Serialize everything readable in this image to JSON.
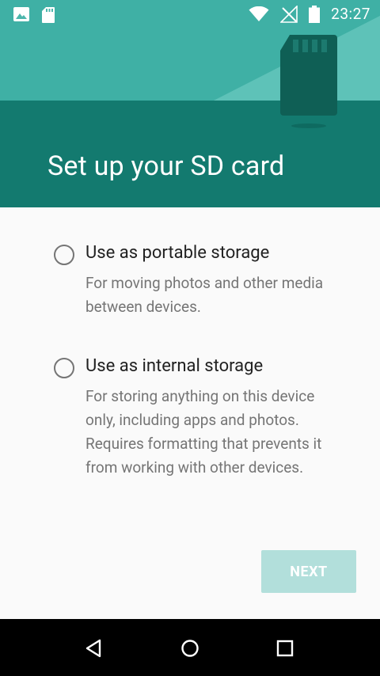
{
  "status_bar": {
    "time": "23:27",
    "icons": [
      "image-icon",
      "sd-card-icon",
      "wifi-icon",
      "no-signal-icon",
      "battery-icon"
    ]
  },
  "header": {
    "title": "Set up your SD card",
    "illustration": "sd-card-icon",
    "colors": {
      "top": "#26a69a",
      "bottom": "#137a6f"
    }
  },
  "options": [
    {
      "title": "Use as portable storage",
      "description": "For moving photos and other media between devices."
    },
    {
      "title": "Use as internal storage",
      "description": "For storing anything on this device only, including apps and photos. Requires formatting that prevents it from working with other devices."
    }
  ],
  "actions": {
    "next_label": "NEXT",
    "next_color": "#b2dfdb"
  },
  "nav_bar": {
    "buttons": [
      "back-icon",
      "home-icon",
      "recents-icon"
    ]
  }
}
